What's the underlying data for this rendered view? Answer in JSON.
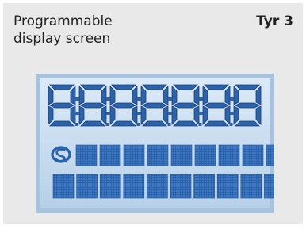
{
  "header": {
    "title_line1": "Programmable",
    "title_line2": "display screen",
    "tag": "Tyr 3"
  },
  "display": {
    "digit_count": 7,
    "dot_matrix_rows": 2,
    "row1_blocks": 9,
    "row2_blocks": 10,
    "symbol_icon": "s-logo-icon",
    "colors": {
      "bezel": "#a7c3dd",
      "screen_top": "#d9e9f6",
      "screen_bottom": "#b9d3ea",
      "segment": "#2a63ac",
      "segment_edge": "#1a3f7a",
      "matrix": "#2b61a8"
    }
  }
}
